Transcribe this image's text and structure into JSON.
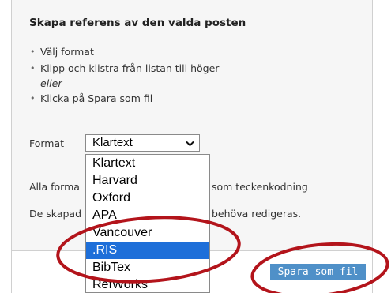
{
  "panel": {
    "heading": "Skapa referens av den valda posten",
    "steps": [
      "Välj format",
      "Klipp och klistra från listan till höger"
    ],
    "or_text": "eller",
    "last_step": "Klicka på Spara som fil",
    "format_label": "Format",
    "selected_format": "Klartext",
    "info_line1_left": "Alla forma",
    "info_line1_right": "som teckenkodning",
    "info_line2_left": "De skapad",
    "info_line2_right": "behöva redigeras."
  },
  "dropdown": {
    "options": [
      "Klartext",
      "Harvard",
      "Oxford",
      "APA",
      "Vancouver",
      ".RIS",
      "BibTex",
      "RefWorks"
    ],
    "highlighted": ".RIS"
  },
  "save_button": {
    "label": "Spara som fil"
  },
  "colors": {
    "highlight": "#1e6fd9",
    "button": "#4f90c8",
    "annotation": "#b3141b"
  },
  "icons": {
    "select_arrow": "chevron-down-icon",
    "bullet": "bullet-icon"
  }
}
